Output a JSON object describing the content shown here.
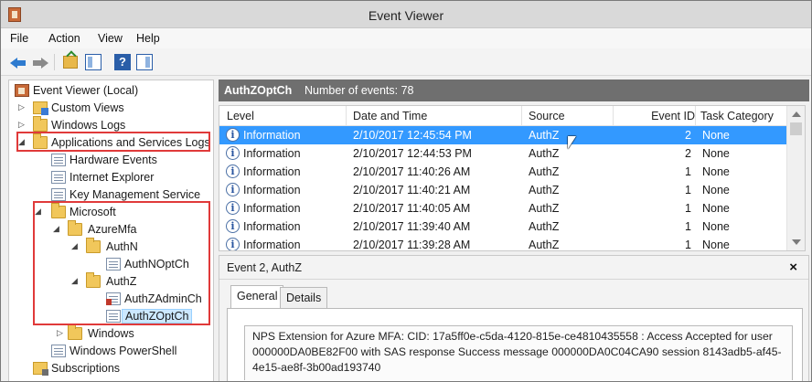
{
  "window": {
    "title": "Event Viewer"
  },
  "menu": [
    "File",
    "Action",
    "View",
    "Help"
  ],
  "toolbar": {
    "icons": [
      "back-arrow-icon",
      "forward-arrow-icon",
      "up-folder-icon",
      "show-pane-icon",
      "help-icon",
      "action-pane-icon"
    ]
  },
  "tree": [
    {
      "label": "Event Viewer (Local)",
      "icon": "event-viewer-icon",
      "arrow": ""
    },
    {
      "label": "Custom Views",
      "icon": "custom-views-icon",
      "arrow": "▷"
    },
    {
      "label": "Windows Logs",
      "icon": "folder-icon",
      "arrow": "▷"
    },
    {
      "label": "Applications and Services Logs",
      "icon": "folder-icon",
      "arrow": "◢"
    },
    {
      "label": "Hardware Events",
      "icon": "log-icon",
      "arrow": ""
    },
    {
      "label": "Internet Explorer",
      "icon": "log-icon",
      "arrow": ""
    },
    {
      "label": "Key Management Service",
      "icon": "log-icon",
      "arrow": ""
    },
    {
      "label": "Microsoft",
      "icon": "folder-icon",
      "arrow": "◢"
    },
    {
      "label": "AzureMfa",
      "icon": "folder-icon",
      "arrow": "◢"
    },
    {
      "label": "AuthN",
      "icon": "folder-icon",
      "arrow": "◢"
    },
    {
      "label": "AuthNOptCh",
      "icon": "log-icon",
      "arrow": ""
    },
    {
      "label": "AuthZ",
      "icon": "folder-icon",
      "arrow": "◢"
    },
    {
      "label": "AuthZAdminCh",
      "icon": "admin-log-icon",
      "arrow": ""
    },
    {
      "label": "AuthZOptCh",
      "icon": "log-icon",
      "arrow": ""
    },
    {
      "label": "Windows",
      "icon": "folder-icon",
      "arrow": "▷"
    },
    {
      "label": "Windows PowerShell",
      "icon": "log-icon",
      "arrow": ""
    },
    {
      "label": "Subscriptions",
      "icon": "subscriptions-icon",
      "arrow": ""
    }
  ],
  "pane": {
    "title": "AuthZOptCh",
    "count": "Number of events: 78"
  },
  "grid": {
    "columns": [
      "Level",
      "Date and Time",
      "Source",
      "Event ID",
      "Task Category"
    ],
    "rows": [
      {
        "level": "Information",
        "date": "2/10/2017 12:45:54 PM",
        "source": "AuthZ",
        "id": "2",
        "category": "None",
        "selected": true
      },
      {
        "level": "Information",
        "date": "2/10/2017 12:44:53 PM",
        "source": "AuthZ",
        "id": "2",
        "category": "None"
      },
      {
        "level": "Information",
        "date": "2/10/2017 11:40:26 AM",
        "source": "AuthZ",
        "id": "1",
        "category": "None"
      },
      {
        "level": "Information",
        "date": "2/10/2017 11:40:21 AM",
        "source": "AuthZ",
        "id": "1",
        "category": "None"
      },
      {
        "level": "Information",
        "date": "2/10/2017 11:40:05 AM",
        "source": "AuthZ",
        "id": "1",
        "category": "None"
      },
      {
        "level": "Information",
        "date": "2/10/2017 11:39:40 AM",
        "source": "AuthZ",
        "id": "1",
        "category": "None"
      },
      {
        "level": "Information",
        "date": "2/10/2017 11:39:28 AM",
        "source": "AuthZ",
        "id": "1",
        "category": "None"
      }
    ]
  },
  "detail": {
    "title": "Event 2, AuthZ",
    "close": "×",
    "tabs": [
      "General",
      "Details"
    ],
    "message": "NPS Extension for Azure MFA:  CID: 17a5ff0e-c5da-4120-815e-ce4810435558 : Access Accepted for user 000000DA0BE82F00 with SAS response Success message 000000DA0C04CA90 session 8143adb5-af45-4e15-ae8f-3b00ad193740"
  },
  "colors": {
    "selection": "#3399ff",
    "highlight_box": "#e03a3a",
    "pane_header": "#6f6f6f"
  }
}
